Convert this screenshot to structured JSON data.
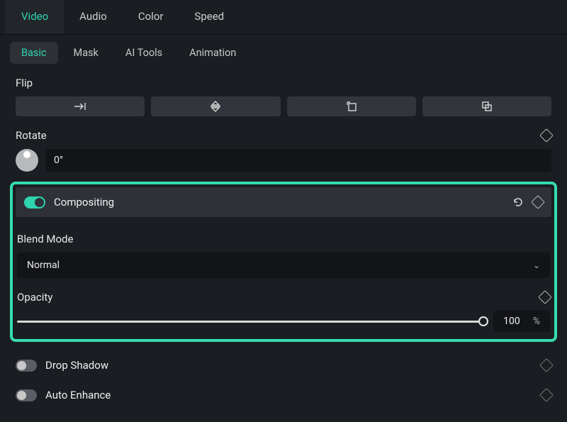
{
  "topTabs": {
    "video": "Video",
    "audio": "Audio",
    "color": "Color",
    "speed": "Speed"
  },
  "subTabs": {
    "basic": "Basic",
    "mask": "Mask",
    "ai": "AI Tools",
    "animation": "Animation"
  },
  "flip": {
    "label": "Flip"
  },
  "rotate": {
    "label": "Rotate",
    "value": "0°"
  },
  "compositing": {
    "label": "Compositing",
    "blendMode": {
      "label": "Blend Mode",
      "value": "Normal"
    },
    "opacity": {
      "label": "Opacity",
      "value": "100",
      "unit": "%"
    }
  },
  "dropShadow": {
    "label": "Drop Shadow"
  },
  "autoEnhance": {
    "label": "Auto Enhance"
  }
}
